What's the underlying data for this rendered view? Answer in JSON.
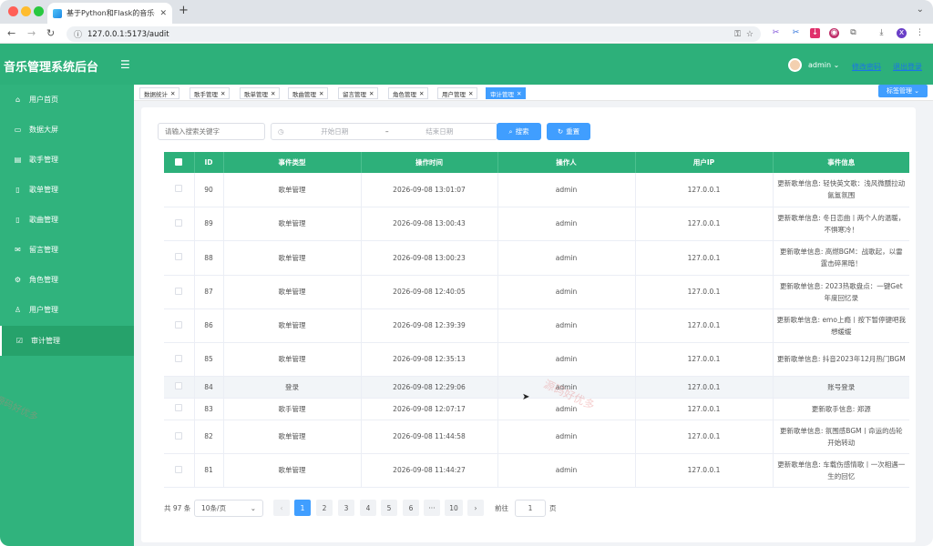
{
  "browser": {
    "tab_title": "基于Python和Flask的音乐平台",
    "url": "127.0.0.1:5173/audit"
  },
  "header": {
    "brand": "音乐管理系统后台",
    "username": "admin",
    "link1": "修改密码",
    "link2": "退出登录"
  },
  "sidebar": {
    "items": [
      {
        "label": "用户首页",
        "icon": "home-icon"
      },
      {
        "label": "数据大屏",
        "icon": "monitor-icon"
      },
      {
        "label": "歌手管理",
        "icon": "document-icon"
      },
      {
        "label": "歌单管理",
        "icon": "notebook-icon"
      },
      {
        "label": "歌曲管理",
        "icon": "phone-icon"
      },
      {
        "label": "留言管理",
        "icon": "mail-icon"
      },
      {
        "label": "角色管理",
        "icon": "gear-icon"
      },
      {
        "label": "用户管理",
        "icon": "user-icon"
      },
      {
        "label": "审计管理",
        "icon": "check-icon"
      }
    ]
  },
  "tags": [
    "数据统计",
    "歌手管理",
    "歌单管理",
    "歌曲管理",
    "留言管理",
    "角色管理",
    "用户管理",
    "审计管理"
  ],
  "tag_manage": "标签管理",
  "search": {
    "keyword_placeholder": "请输入搜索关键字",
    "start_placeholder": "开始日期",
    "range_sep": "–",
    "end_placeholder": "结束日期",
    "search_btn": "搜索",
    "reset_btn": "重置"
  },
  "table": {
    "columns": [
      "ID",
      "事件类型",
      "操作时间",
      "操作人",
      "用户IP",
      "事件信息"
    ],
    "rows": [
      {
        "id": "90",
        "type": "歌单管理",
        "time": "2026-09-08 13:01:07",
        "user": "admin",
        "ip": "127.0.0.1",
        "info": "更新歌单信息: 轻快英文歌：浅风微醺拉动氤氲氛围"
      },
      {
        "id": "89",
        "type": "歌单管理",
        "time": "2026-09-08 13:00:43",
        "user": "admin",
        "ip": "127.0.0.1",
        "info": "更新歌单信息: 冬日恋曲丨两个人的温暖，不惧寒冷！"
      },
      {
        "id": "88",
        "type": "歌单管理",
        "time": "2026-09-08 13:00:23",
        "user": "admin",
        "ip": "127.0.0.1",
        "info": "更新歌单信息: 高燃BGM：战歌起，以雷霆击碎黑暗！"
      },
      {
        "id": "87",
        "type": "歌单管理",
        "time": "2026-09-08 12:40:05",
        "user": "admin",
        "ip": "127.0.0.1",
        "info": "更新歌单信息: 2023热歌盘点：一键Get年度回忆录"
      },
      {
        "id": "86",
        "type": "歌单管理",
        "time": "2026-09-08 12:39:39",
        "user": "admin",
        "ip": "127.0.0.1",
        "info": "更新歌单信息: emo上瘾丨按下暂停键吧我想缓缓"
      },
      {
        "id": "85",
        "type": "歌单管理",
        "time": "2026-09-08 12:35:13",
        "user": "admin",
        "ip": "127.0.0.1",
        "info": "更新歌单信息: 抖音2023年12月热门BGM"
      },
      {
        "id": "84",
        "type": "登录",
        "time": "2026-09-08 12:29:06",
        "user": "admin",
        "ip": "127.0.0.1",
        "info": "账号登录"
      },
      {
        "id": "83",
        "type": "歌手管理",
        "time": "2026-09-08 12:07:17",
        "user": "admin",
        "ip": "127.0.0.1",
        "info": "更新歌手信息: 郑源"
      },
      {
        "id": "82",
        "type": "歌单管理",
        "time": "2026-09-08 11:44:58",
        "user": "admin",
        "ip": "127.0.0.1",
        "info": "更新歌单信息: 氛围感BGM丨命运的齿轮开始转动"
      },
      {
        "id": "81",
        "type": "歌单管理",
        "time": "2026-09-08 11:44:27",
        "user": "admin",
        "ip": "127.0.0.1",
        "info": "更新歌单信息: 车载伤感情歌丨一次相遇一生的回忆"
      }
    ]
  },
  "pagination": {
    "total": "共 97 条",
    "page_size": "10条/页",
    "prev": "‹",
    "next": "›",
    "pages": [
      "1",
      "2",
      "3",
      "4",
      "5",
      "6",
      "···",
      "10"
    ],
    "goto_label": "前往",
    "goto_value": "1",
    "goto_suffix": "页"
  },
  "watermark": "源码好优多"
}
